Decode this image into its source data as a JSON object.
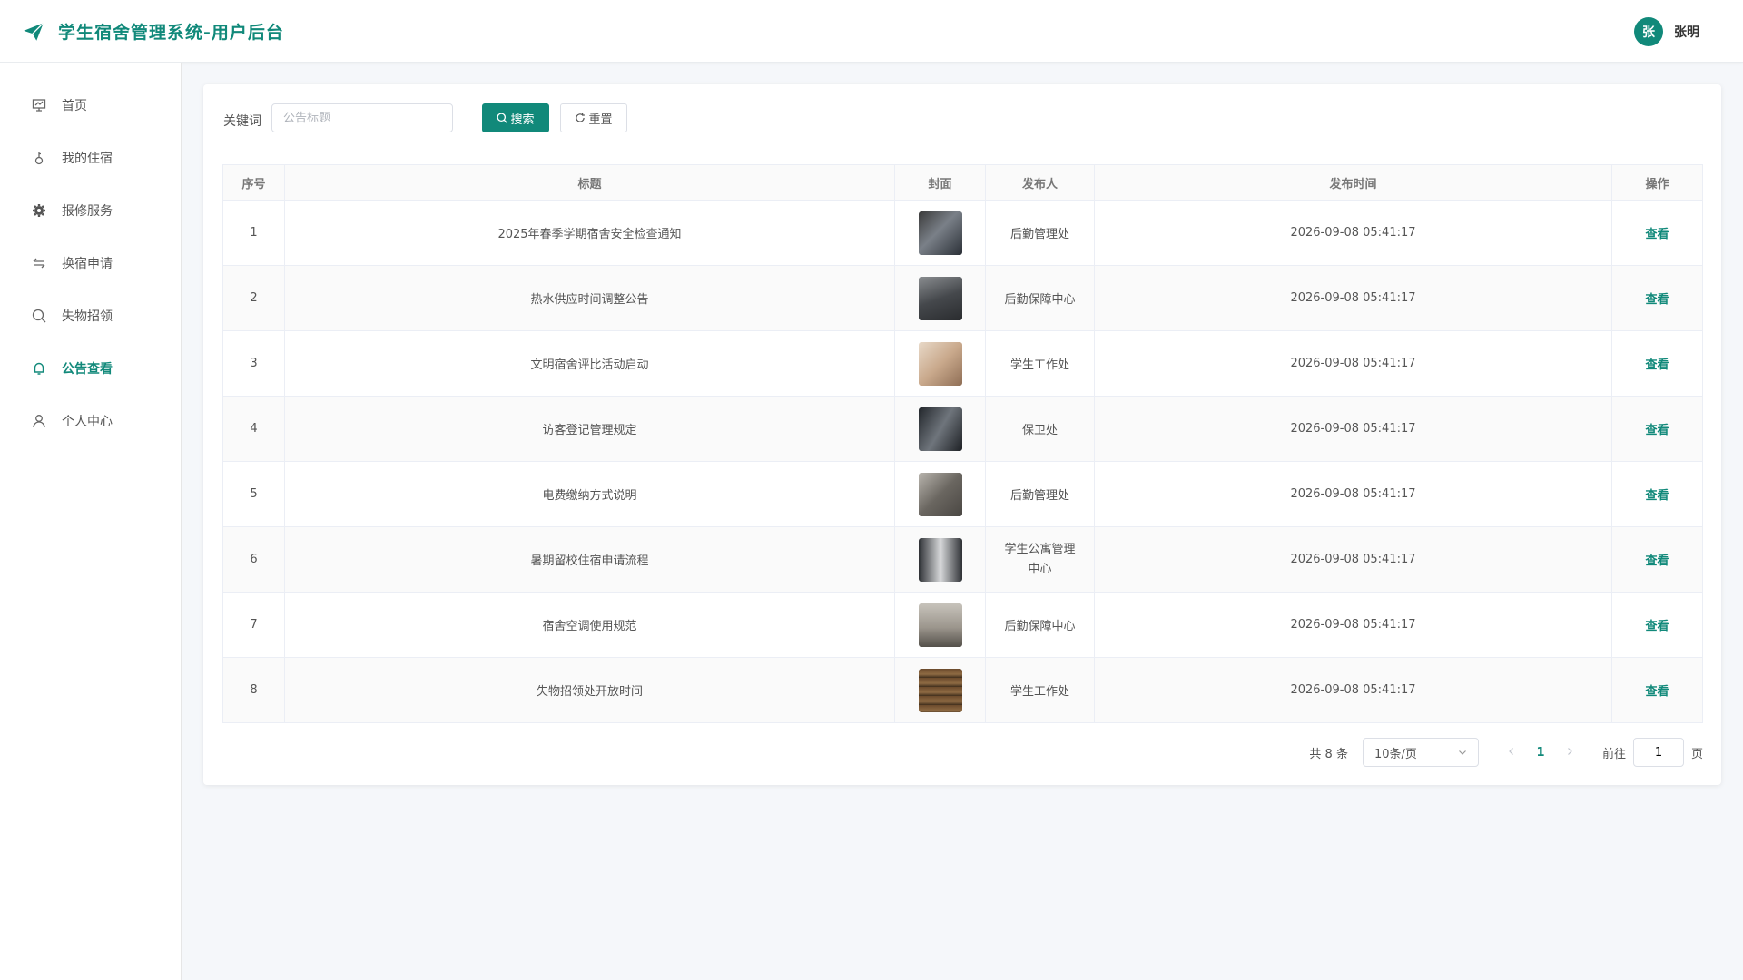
{
  "header": {
    "title": "学生宿舍管理系统-用户后台",
    "user": {
      "avatar_text": "张",
      "name": "张明"
    }
  },
  "sidebar": {
    "items": [
      {
        "label": "首页",
        "icon": "presentation-icon",
        "active": false
      },
      {
        "label": "我的住宿",
        "icon": "key-icon",
        "active": false
      },
      {
        "label": "报修服务",
        "icon": "gear-icon",
        "active": false
      },
      {
        "label": "换宿申请",
        "icon": "swap-icon",
        "active": false
      },
      {
        "label": "失物招领",
        "icon": "search-icon",
        "active": false
      },
      {
        "label": "公告查看",
        "icon": "bell-icon",
        "active": true
      },
      {
        "label": "个人中心",
        "icon": "user-icon",
        "active": false
      }
    ]
  },
  "search": {
    "label": "关键词",
    "placeholder": "公告标题",
    "value": "",
    "search_button": "搜索",
    "reset_button": "重置"
  },
  "table": {
    "headers": [
      "序号",
      "标题",
      "封面",
      "发布人",
      "发布时间",
      "操作"
    ],
    "rows": [
      {
        "index": "1",
        "title": "2025年春季学期宿舍安全检查通知",
        "publisher": "后勤管理处",
        "time": "2026-09-08 05:41:17",
        "action": "查看"
      },
      {
        "index": "2",
        "title": "热水供应时间调整公告",
        "publisher": "后勤保障中心",
        "time": "2026-09-08 05:41:17",
        "action": "查看"
      },
      {
        "index": "3",
        "title": "文明宿舍评比活动启动",
        "publisher": "学生工作处",
        "time": "2026-09-08 05:41:17",
        "action": "查看"
      },
      {
        "index": "4",
        "title": "访客登记管理规定",
        "publisher": "保卫处",
        "time": "2026-09-08 05:41:17",
        "action": "查看"
      },
      {
        "index": "5",
        "title": "电费缴纳方式说明",
        "publisher": "后勤管理处",
        "time": "2026-09-08 05:41:17",
        "action": "查看"
      },
      {
        "index": "6",
        "title": "暑期留校住宿申请流程",
        "publisher": "学生公寓管理中心",
        "time": "2026-09-08 05:41:17",
        "action": "查看"
      },
      {
        "index": "7",
        "title": "宿舍空调使用规范",
        "publisher": "后勤保障中心",
        "time": "2026-09-08 05:41:17",
        "action": "查看"
      },
      {
        "index": "8",
        "title": "失物招领处开放时间",
        "publisher": "学生工作处",
        "time": "2026-09-08 05:41:17",
        "action": "查看"
      }
    ]
  },
  "pagination": {
    "total_text": "共 8 条",
    "page_size": "10条/页",
    "current_page": "1",
    "goto_label": "前往",
    "goto_value": "1",
    "page_unit": "页"
  },
  "colors": {
    "accent": "#11897a"
  }
}
